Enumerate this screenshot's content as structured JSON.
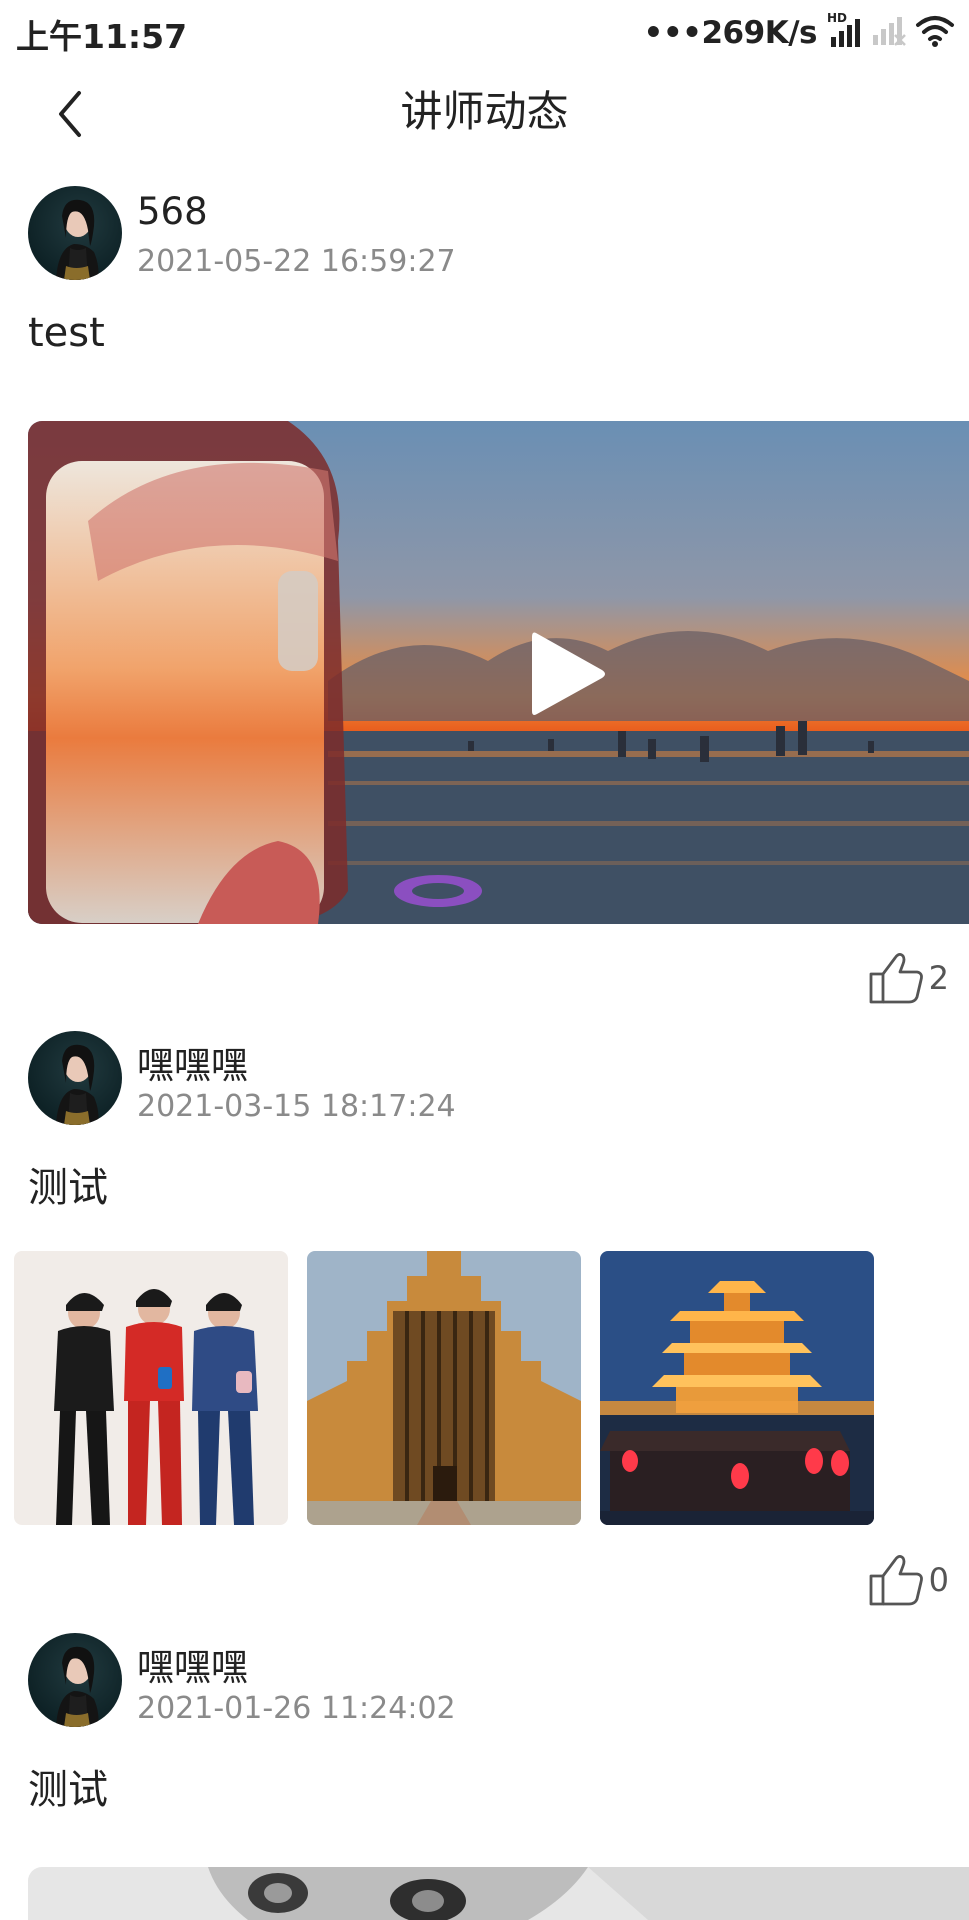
{
  "status_bar": {
    "time": "上午11:57",
    "network_speed": "•••269K/s",
    "hd_label": "HD",
    "icons": [
      "signal-icon",
      "signal-empty-icon",
      "wifi-icon"
    ]
  },
  "header": {
    "back_icon": "chevron-left-icon",
    "title": "讲师动态"
  },
  "posts": [
    {
      "author": "568",
      "time": "2021-05-22 16:59:27",
      "text": "test",
      "media_type": "video",
      "likes": "2"
    },
    {
      "author": "嘿嘿嘿",
      "time": "2021-03-15 18:17:24",
      "text": "测试",
      "media_type": "images",
      "likes": "0"
    },
    {
      "author": "嘿嘿嘿",
      "time": "2021-01-26 11:24:02",
      "text": "测试",
      "media_type": "image"
    }
  ],
  "colors": {
    "text_primary": "#222222",
    "text_secondary": "#8a8a8a",
    "background": "#ffffff"
  }
}
